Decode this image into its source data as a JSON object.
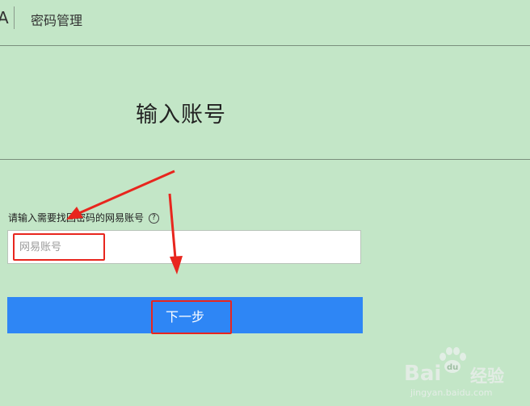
{
  "header": {
    "logo_fragment": "A",
    "title": "密码管理"
  },
  "main": {
    "page_title": "输入账号",
    "field_label": "请输入需要找回密码的网易账号",
    "help_icon_glyph": "?",
    "account_input": {
      "placeholder": "网易账号",
      "value": ""
    },
    "next_button_label": "下一步"
  },
  "annotations": {
    "color": "#e8261e"
  },
  "watermark": {
    "brand": "Bai",
    "brand_suffix": "经验",
    "paw_glyph": "du",
    "url": "jingyan.baidu.com"
  },
  "colors": {
    "background": "#c3e6c7",
    "button": "#2e86f5"
  }
}
